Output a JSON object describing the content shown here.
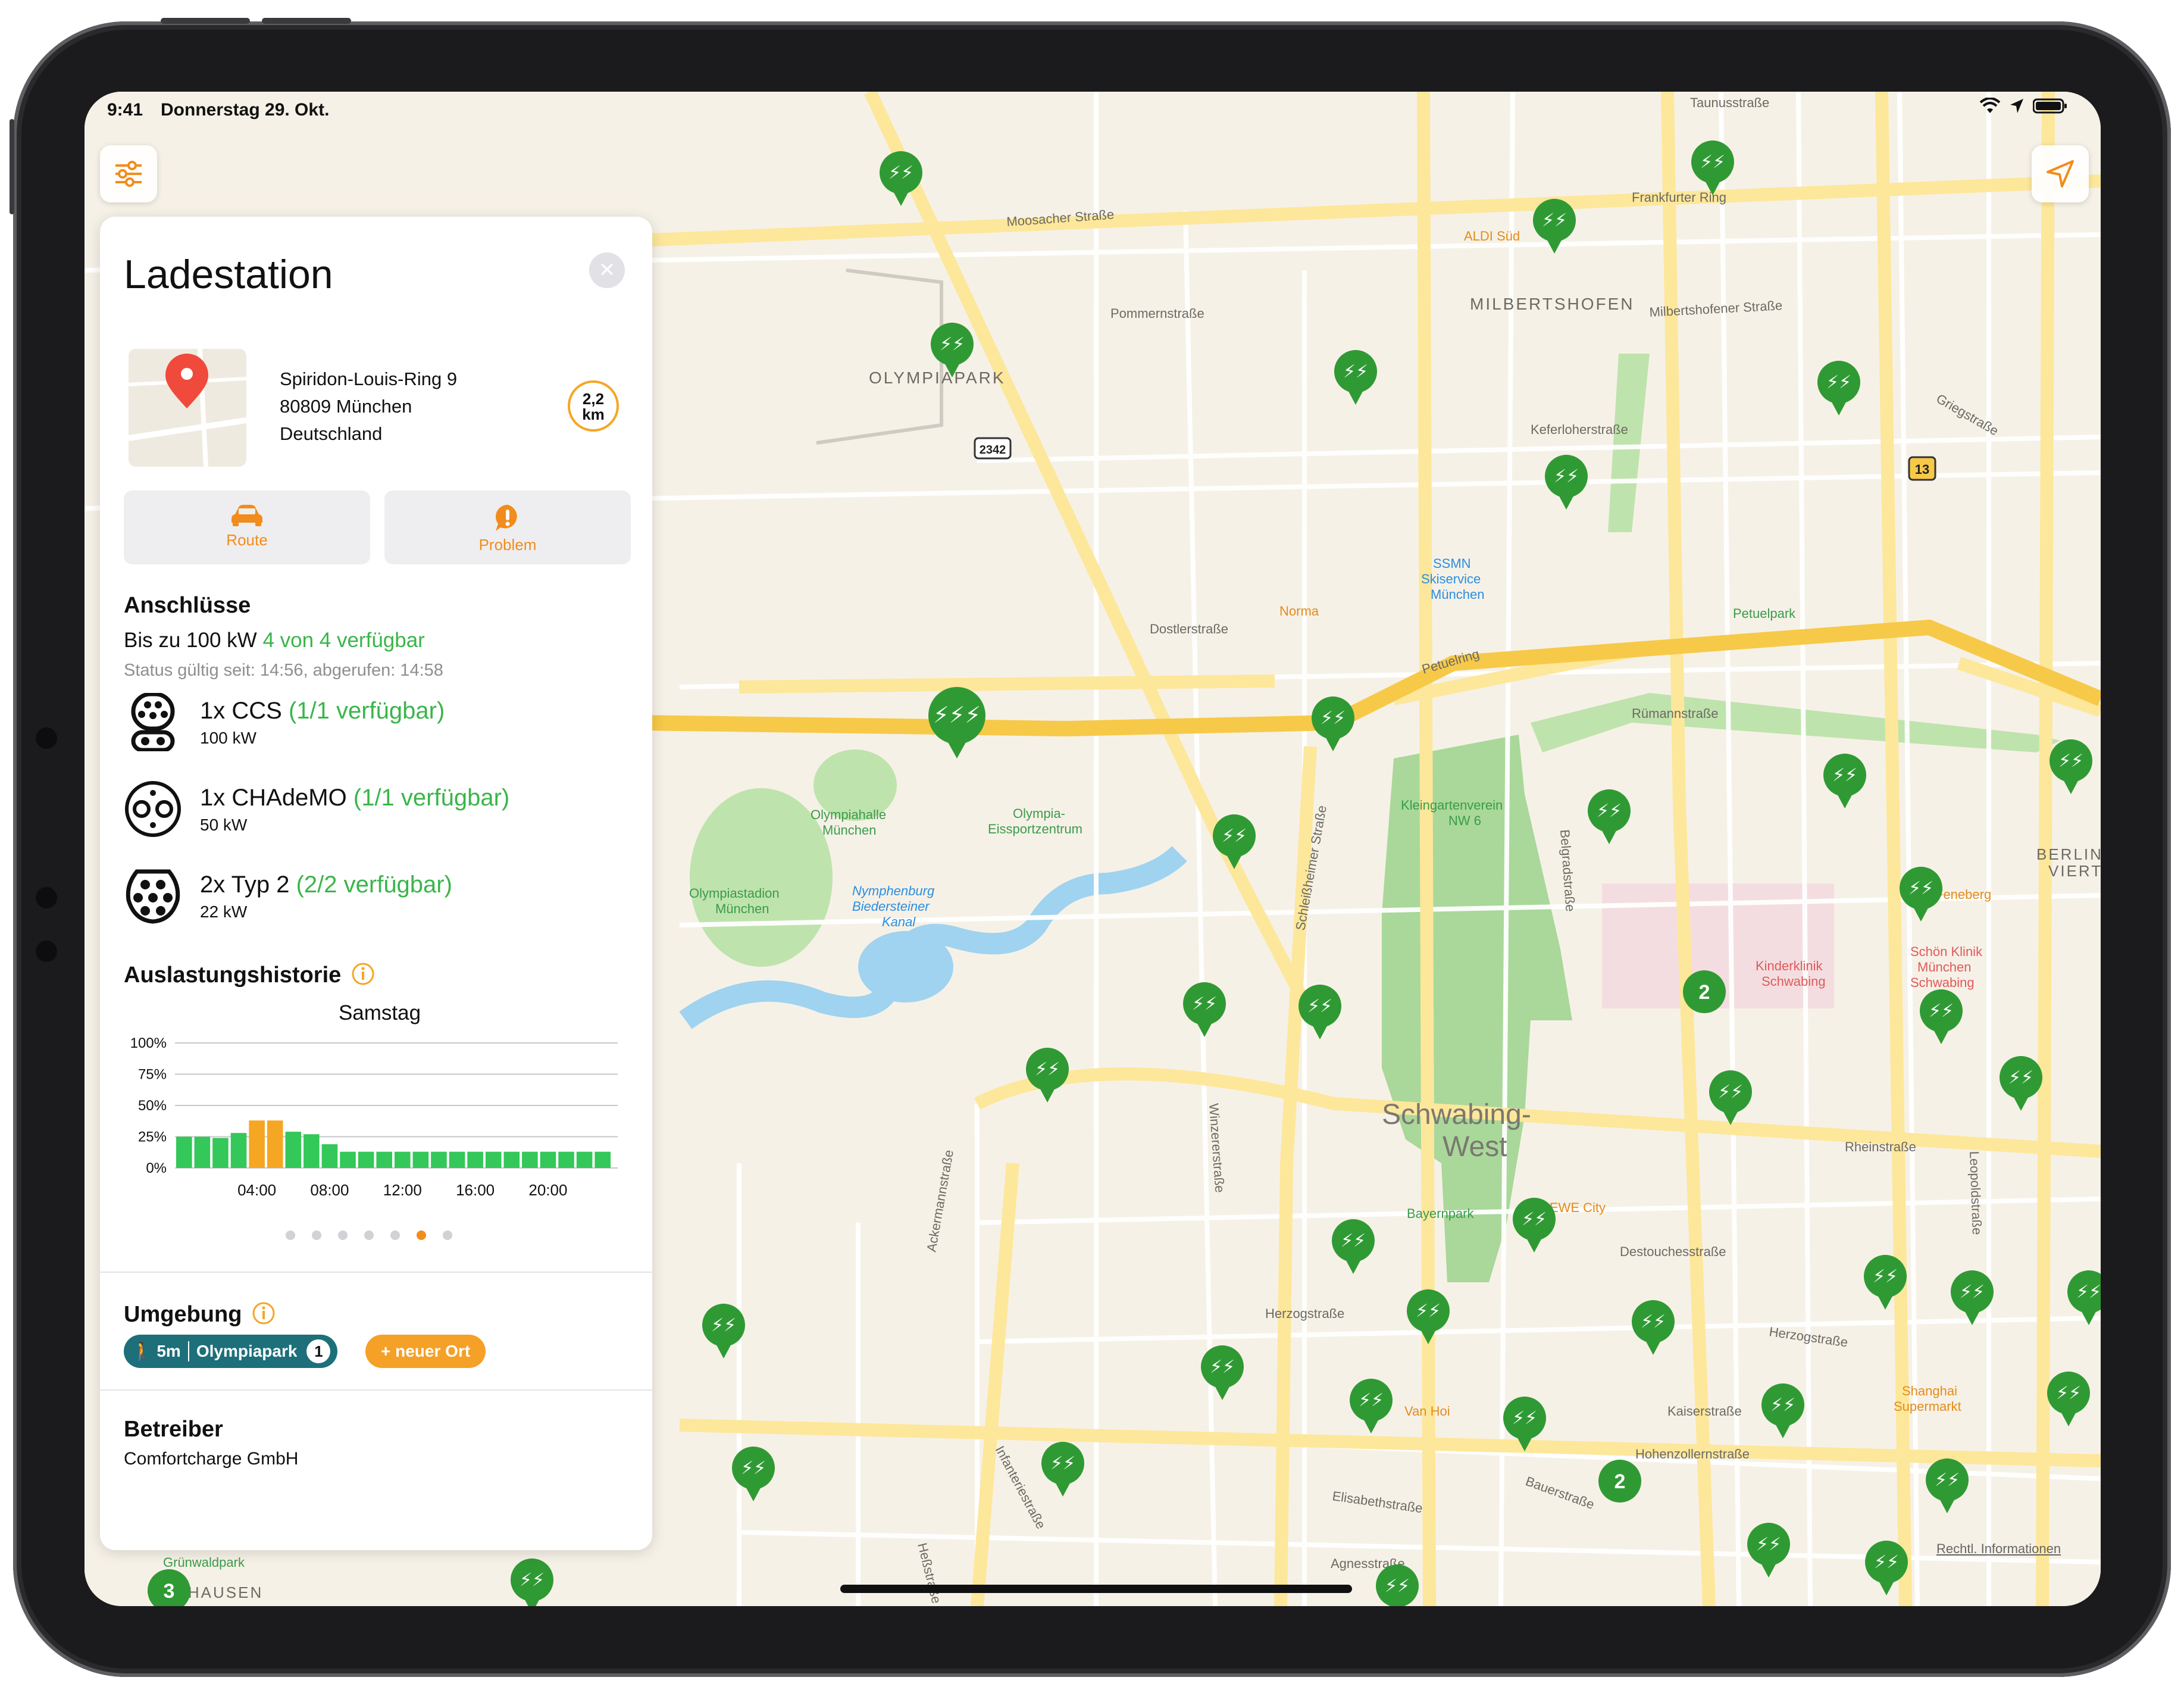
{
  "status_bar": {
    "time": "9:41",
    "date": "Donnerstag 29. Okt."
  },
  "panel": {
    "title": "Ladestation",
    "address": [
      "Spiridon-Louis-Ring 9",
      "80809 München",
      "Deutschland"
    ],
    "distance_value": "2,2",
    "distance_unit": "km",
    "actions": {
      "route": "Route",
      "problem": "Problem"
    },
    "connections": {
      "heading": "Anschlüsse",
      "power_prefix": "Bis zu 100 kW",
      "availability": "4 von 4 verfügbar",
      "status_line": "Status gültig seit: 14:56, abgerufen: 14:58",
      "items": [
        {
          "name": "1x CCS",
          "avail": "(1/1 verfügbar)",
          "power": "100 kW",
          "icon": "ccs-plug-icon"
        },
        {
          "name": "1x CHAdeMO",
          "avail": "(1/1 verfügbar)",
          "power": "50 kW",
          "icon": "chademo-plug-icon"
        },
        {
          "name": "2x Typ 2",
          "avail": "(2/2 verfügbar)",
          "power": "22 kW",
          "icon": "type2-plug-icon"
        }
      ]
    },
    "history": {
      "heading": "Auslastungshistorie",
      "day": "Samstag",
      "page_dots": 7,
      "active_dot": 6
    },
    "surroundings": {
      "heading": "Umgebung",
      "walk_time": "5m",
      "place": "Olympiapark",
      "place_count": "1",
      "new_place": "+ neuer Ort"
    },
    "operator": {
      "heading": "Betreiber",
      "name": "Comfortcharge GmbH"
    }
  },
  "chart_data": {
    "type": "bar",
    "title": "Samstag",
    "xlabel": "",
    "ylabel": "",
    "yticks": [
      "100%",
      "75%",
      "50%",
      "25%",
      "0%"
    ],
    "xticks": [
      "04:00",
      "08:00",
      "12:00",
      "16:00",
      "20:00"
    ],
    "ylim": [
      0,
      100
    ],
    "grid": true,
    "categories": [
      "00",
      "01",
      "02",
      "03",
      "04",
      "05",
      "06",
      "07",
      "08",
      "09",
      "10",
      "11",
      "12",
      "13",
      "14",
      "15",
      "16",
      "17",
      "18",
      "19",
      "20",
      "21",
      "22",
      "23"
    ],
    "values": [
      25,
      25,
      24,
      28,
      38,
      38,
      29,
      27,
      19,
      13,
      13,
      13,
      13,
      13,
      13,
      13,
      13,
      13,
      13,
      13,
      13,
      13,
      13,
      13
    ],
    "highlight_indices": [
      4,
      5
    ],
    "colors": {
      "normal": "#34c759",
      "highlight": "#f5a623"
    }
  },
  "map": {
    "labels": [
      "Taunusstraße",
      "ALDI Süd",
      "Frankfurter Ring",
      "Moosacher Straße",
      "MILBERTSHOFEN",
      "Milbertshofener Straße",
      "Pommernstraße",
      "OLYMPIAPARK",
      "2342",
      "Griegstraße",
      "13",
      "Keferloherstraße",
      "SSMN Skiservice München",
      "Norma",
      "Petuelpark",
      "Dostlerstraße",
      "Petuelring",
      "Rümannstraße",
      "Olympiahalle München",
      "Olympia-Eissportzentrum",
      "Kleingartenverein NW 6",
      "BERLINER VIERTEL",
      "Feneberg",
      "Olympiastadion München",
      "Nymphenburg Biedersteiner Kanal",
      "Schön Klinik München Schwabing",
      "Kinderklinik Schwabing",
      "Schwabing-West",
      "Rheinstraße",
      "Bayernpark",
      "REWE City",
      "Destouchesstraße",
      "Herzogstraße",
      "Van Hoi",
      "Kaiserstraße",
      "Shanghai Supermarkt",
      "Hohenzollernstraße",
      "Elisabethstraße",
      "Bauerstraße",
      "Grünwaldpark",
      "NEUHAUSEN",
      "Agnesstraße",
      "Ackermannstraße",
      "Winzererstraße",
      "Schleißheimer Straße",
      "Belgradstraße",
      "Leopoldstraße",
      "Infanteriestraße",
      "Heßstraße",
      "Rechtl. Informationen"
    ],
    "clusters": [
      "2",
      "2",
      "3"
    ]
  }
}
